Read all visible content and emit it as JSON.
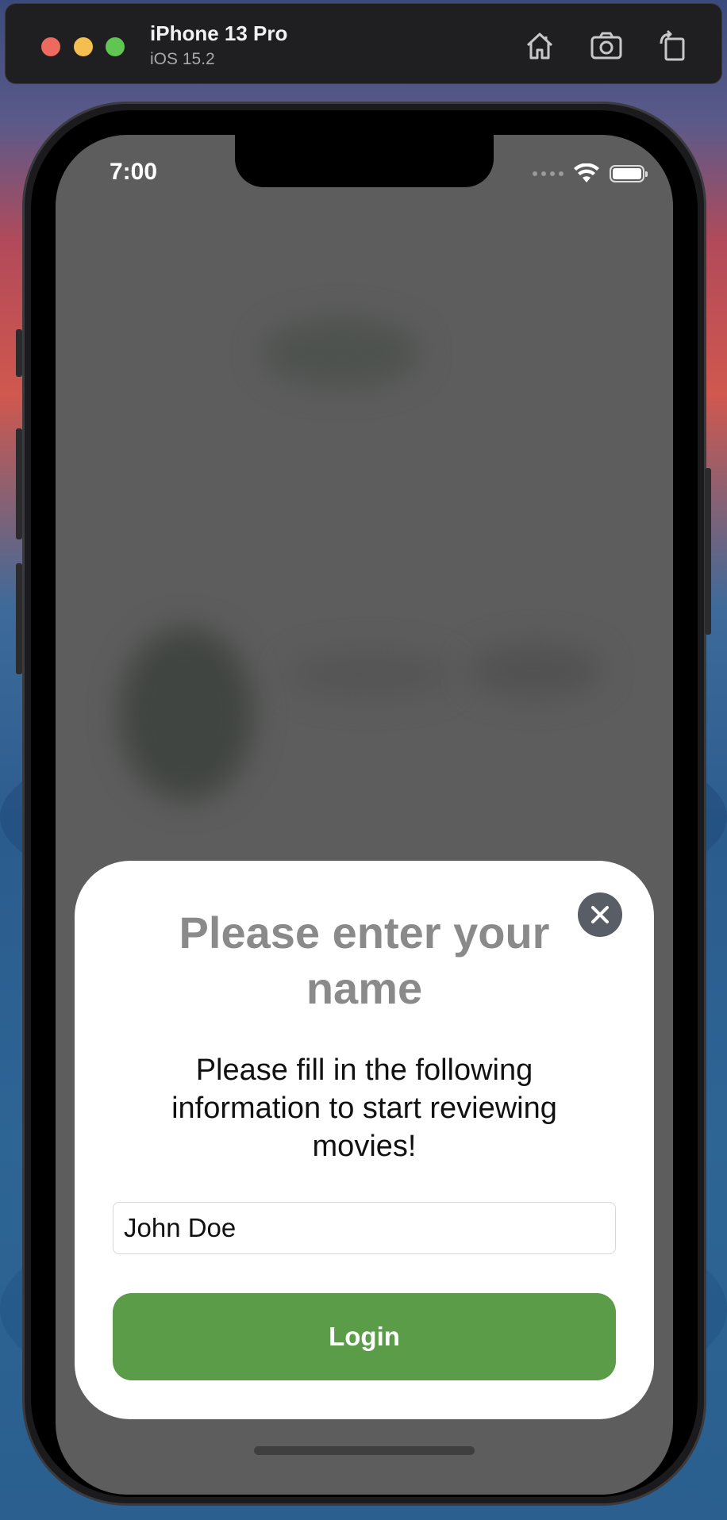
{
  "simulator": {
    "device_name": "iPhone 13 Pro",
    "os_version": "iOS 15.2",
    "toolbar": [
      {
        "icon": "home-icon"
      },
      {
        "icon": "screenshot-camera-icon"
      },
      {
        "icon": "rotate-icon"
      }
    ]
  },
  "status_bar": {
    "time": "7:00",
    "icons": [
      "cellular-signal-icon",
      "wifi-icon",
      "battery-icon"
    ]
  },
  "modal": {
    "title": "Please enter your name",
    "description": "Please fill in the following information to start reviewing movies!",
    "name_input": {
      "value": "John Doe",
      "placeholder": ""
    },
    "login_label": "Login",
    "close_icon": "close-icon"
  },
  "colors": {
    "login_button": "#5b9c48",
    "title": "#8a8a8a",
    "close_button": "#595d66",
    "backdrop": "#5d5d5d"
  }
}
